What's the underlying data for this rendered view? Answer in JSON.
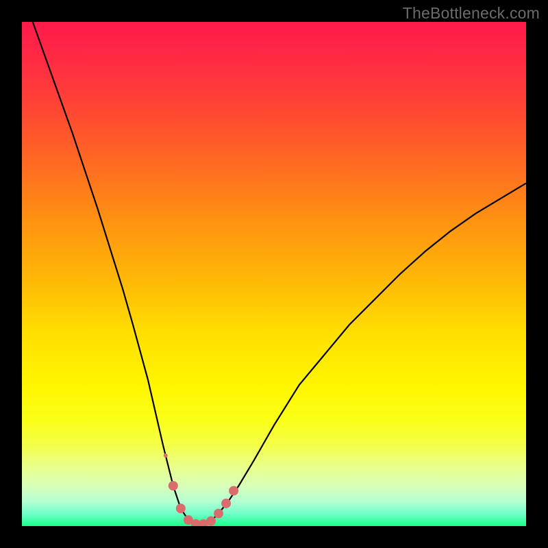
{
  "watermark": "TheBottleneck.com",
  "chart_data": {
    "type": "line",
    "title": "",
    "xlabel": "",
    "ylabel": "",
    "xlim": [
      0,
      100
    ],
    "ylim": [
      0,
      100
    ],
    "x": [
      0,
      5,
      10,
      15,
      20,
      22,
      25,
      28,
      30,
      31.5,
      33,
      34.5,
      36,
      37.5,
      39,
      41,
      43,
      46,
      50,
      55,
      60,
      65,
      70,
      75,
      80,
      85,
      90,
      95,
      100
    ],
    "values": [
      106,
      92,
      78,
      63,
      47,
      40,
      29,
      16,
      8,
      3.5,
      1.2,
      0.4,
      0.4,
      1.0,
      2.5,
      5,
      8,
      13,
      20,
      28,
      34,
      40,
      45,
      50,
      54.5,
      58.5,
      62,
      65,
      68
    ],
    "highlighted_points": [
      {
        "x": 28.5,
        "y": 14,
        "r": 3
      },
      {
        "x": 30.0,
        "y": 8,
        "r": 7
      },
      {
        "x": 31.5,
        "y": 3.5,
        "r": 7
      },
      {
        "x": 33.0,
        "y": 1.2,
        "r": 7
      },
      {
        "x": 34.5,
        "y": 0.4,
        "r": 7
      },
      {
        "x": 36.0,
        "y": 0.4,
        "r": 7
      },
      {
        "x": 37.5,
        "y": 1.0,
        "r": 7
      },
      {
        "x": 39.0,
        "y": 2.5,
        "r": 7
      },
      {
        "x": 40.5,
        "y": 4.5,
        "r": 7
      },
      {
        "x": 42.0,
        "y": 7.0,
        "r": 7
      }
    ],
    "colors": {
      "curve": "#000000",
      "highlight": "#d96d6e",
      "gradient_top": "#ff1a4b",
      "gradient_bottom": "#19ff8a"
    }
  }
}
